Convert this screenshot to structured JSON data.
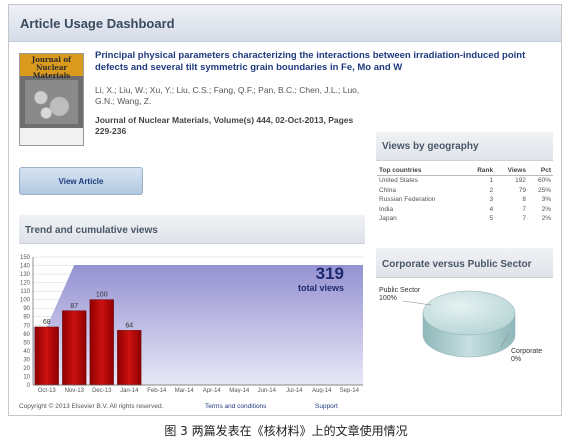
{
  "dashboard": {
    "title": "Article Usage Dashboard",
    "article_title": "Principal physical parameters characterizing the interactions between irradiation-induced point defects and several tilt symmetric grain boundaries in Fe, Mo and W",
    "authors": "Li, X.; Liu, W.; Xu, Y.; Liu, C.S.; Fang, Q.F.; Pan, B.C.; Chen, J.L.; Luo, G.N.; Wang, Z.",
    "journal": "Journal of Nuclear Materials, Volume(s) 444, 02-Oct-2013, Pages 229-236",
    "cover_title": "Journal of Nuclear Materials",
    "view_button": "View Article"
  },
  "geography": {
    "title": "Views by geography",
    "headers": [
      "Top countries",
      "Rank",
      "Views",
      "Pct"
    ],
    "rows": [
      [
        "United States",
        "1",
        "192",
        "60%"
      ],
      [
        "China",
        "2",
        "79",
        "25%"
      ],
      [
        "Russian Federation",
        "3",
        "8",
        "3%"
      ],
      [
        "India",
        "4",
        "7",
        "2%"
      ],
      [
        "Japan",
        "5",
        "7",
        "2%"
      ]
    ]
  },
  "trend": {
    "title": "Trend and cumulative views",
    "total_number": "319",
    "total_label": "total views"
  },
  "corporate": {
    "title": "Corporate versus Public Sector",
    "public_label": "Public Sector",
    "public_pct": "100%",
    "corporate_label": "Corporate",
    "corporate_pct": "0%"
  },
  "footer": {
    "copyright": "Copyright © 2013 Elsevier B.V. All rights reserved.",
    "terms": "Terms and conditions",
    "support": "Support"
  },
  "caption": "图 3 两篇发表在《核材料》上的文章使用情况",
  "chart_data": {
    "type": "bar",
    "categories": [
      "Oct-13",
      "Nov-13",
      "Dec-13",
      "Jan-14",
      "Feb-14",
      "Mar-14",
      "Apr-14",
      "May-14",
      "Jun-14",
      "Jul-14",
      "Aug-14",
      "Sep-14"
    ],
    "values": [
      68,
      87,
      100,
      64,
      null,
      null,
      null,
      null,
      null,
      null,
      null,
      null
    ],
    "cumulative": [
      68,
      155,
      255,
      319,
      319,
      319,
      319,
      319,
      319,
      319,
      319,
      319
    ],
    "ylim": [
      0,
      150
    ],
    "yticks": [
      0,
      10,
      20,
      30,
      40,
      50,
      60,
      70,
      80,
      90,
      100,
      110,
      120,
      130,
      140,
      150
    ],
    "grid": true,
    "colors": {
      "bar": "#cc1111",
      "cumulative": "#8f8ccf"
    }
  }
}
